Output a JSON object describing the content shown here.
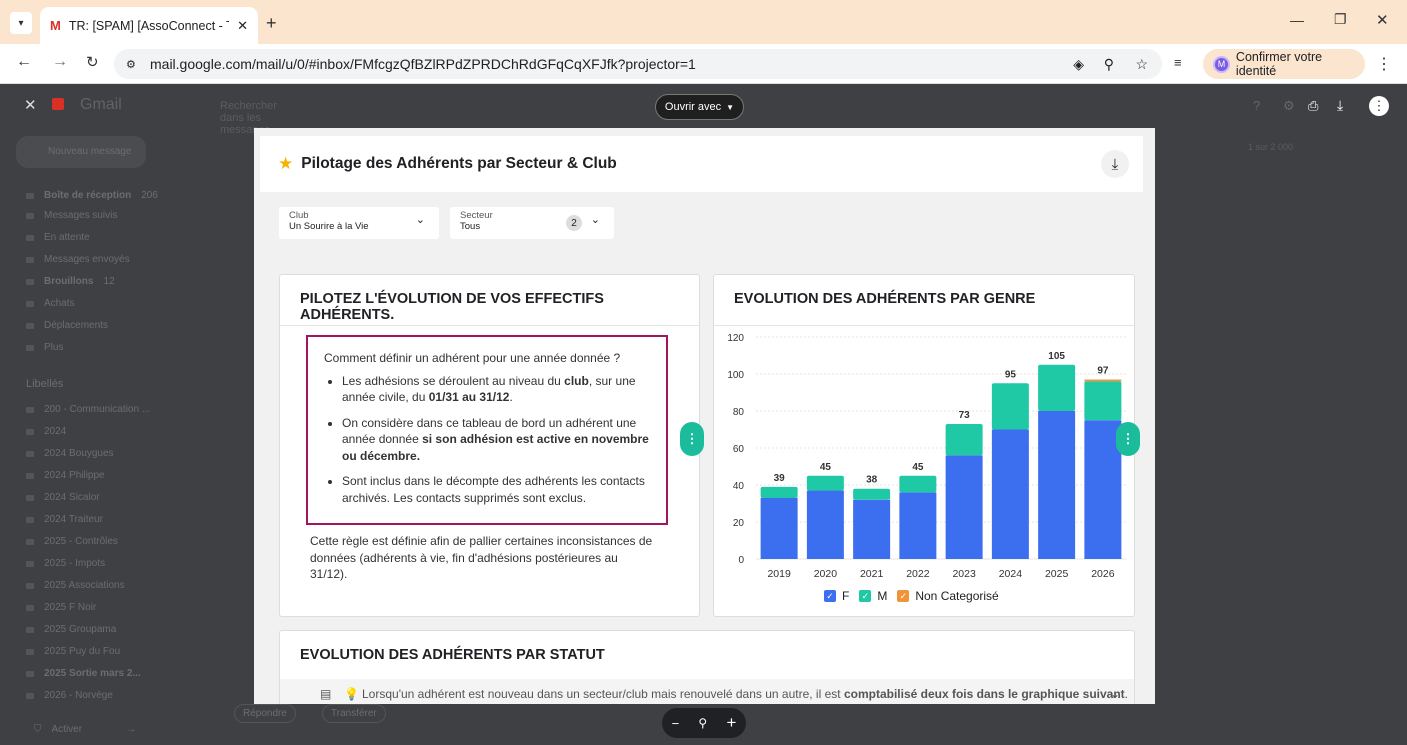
{
  "browser": {
    "tab_title": "TR: [SPAM] [AssoConnect - Tick",
    "url": "mail.google.com/mail/u/0/#inbox/FMfcgzQfBZlRPdZPRDChRdGFqCqXFJfk?projector=1",
    "verify_label": "Confirmer votre identité",
    "verify_avatar": "M"
  },
  "gmail": {
    "brand": "Gmail",
    "search_placeholder": "Rechercher dans les messages",
    "compose": "Nouveau message",
    "folders": [
      {
        "label": "Boîte de réception",
        "count": "206"
      },
      {
        "label": "Messages suivis",
        "count": ""
      },
      {
        "label": "En attente",
        "count": ""
      },
      {
        "label": "Messages envoyés",
        "count": ""
      },
      {
        "label": "Brouillons",
        "count": "12"
      },
      {
        "label": "Achats",
        "count": ""
      },
      {
        "label": "Déplacements",
        "count": ""
      },
      {
        "label": "Plus",
        "count": ""
      }
    ],
    "labels_title": "Libellés",
    "labels": [
      "200 - Communication ...",
      "2024",
      "2024 Bouygues",
      "2024 Philippe",
      "2024 Sicalor",
      "2024 Traiteur",
      "2025 - Contrôles",
      "2025 - Impots",
      "2025 Associations",
      "2025 F Noir",
      "2025 Groupama",
      "2025 Puy du Fou",
      "2025 Sortie mars 2...",
      "2026 - Norvège"
    ],
    "reply": "Répondre",
    "forward": "Transférer",
    "activate": "Activer",
    "pager": "1 sur 2 000"
  },
  "viewer": {
    "open_with": "Ouvrir avec"
  },
  "report": {
    "title": "Pilotage des Adhérents par Secteur & Club",
    "filters": [
      {
        "label": "Club",
        "value": "Un Sourire à la Vie",
        "badge": ""
      },
      {
        "label": "Secteur",
        "value": "Tous",
        "badge": "2"
      }
    ],
    "rules_card": {
      "title": "PILOTEZ L'ÉVOLUTION DE VOS EFFECTIFS ADHÉRENTS.",
      "question": "Comment définir un adhérent pour une année donnée ?",
      "b1_a": "Les adhésions se déroulent au niveau du ",
      "b1_b": "club",
      "b1_c": ", sur une année civile, du ",
      "b1_d": "01/31 au 31/12",
      "b1_e": ".",
      "b2_a": "On considère dans ce tableau de bord un adhérent une année donnée ",
      "b2_b": "si son adhésion est active en novembre ou décembre.",
      "b3": "Sont inclus dans le décompte des adhérents les contacts archivés. Les contacts supprimés sont exclus.",
      "outro": "Cette règle est définie afin de pallier certaines inconsistances de données (adhérents à vie, fin d'adhésions postérieures au 31/12)."
    },
    "status_card": {
      "title": "EVOLUTION DES ADHÉRENTS PAR STATUT",
      "note_a": "Lorsqu'un adhérent est nouveau dans un secteur/club mais renouvelé dans un autre, il est ",
      "note_b": "comptabilisé deux fois dans le graphique suivant",
      "note_c": "."
    },
    "colors": {
      "f": "#3b6ff0",
      "m": "#1fc9a5",
      "nc": "#f0943a"
    }
  },
  "chart_data": {
    "type": "bar",
    "title": "EVOLUTION DES ADHÉRENTS PAR GENRE",
    "categories": [
      "2019",
      "2020",
      "2021",
      "2022",
      "2023",
      "2024",
      "2025",
      "2026"
    ],
    "series": [
      {
        "name": "F",
        "values": [
          33,
          37,
          32,
          36,
          56,
          70,
          80,
          75
        ]
      },
      {
        "name": "M",
        "values": [
          6,
          8,
          6,
          9,
          17,
          25,
          25,
          21
        ]
      },
      {
        "name": "Non Categorisé",
        "values": [
          0,
          0,
          0,
          0,
          0,
          0,
          0,
          1
        ]
      }
    ],
    "totals": [
      "39",
      "45",
      "38",
      "45",
      "73",
      "95",
      "105",
      "97"
    ],
    "yticks": [
      "0",
      "20",
      "40",
      "60",
      "80",
      "100",
      "120"
    ],
    "ylim": [
      0,
      120
    ],
    "grid": true,
    "legend": "bottom"
  }
}
